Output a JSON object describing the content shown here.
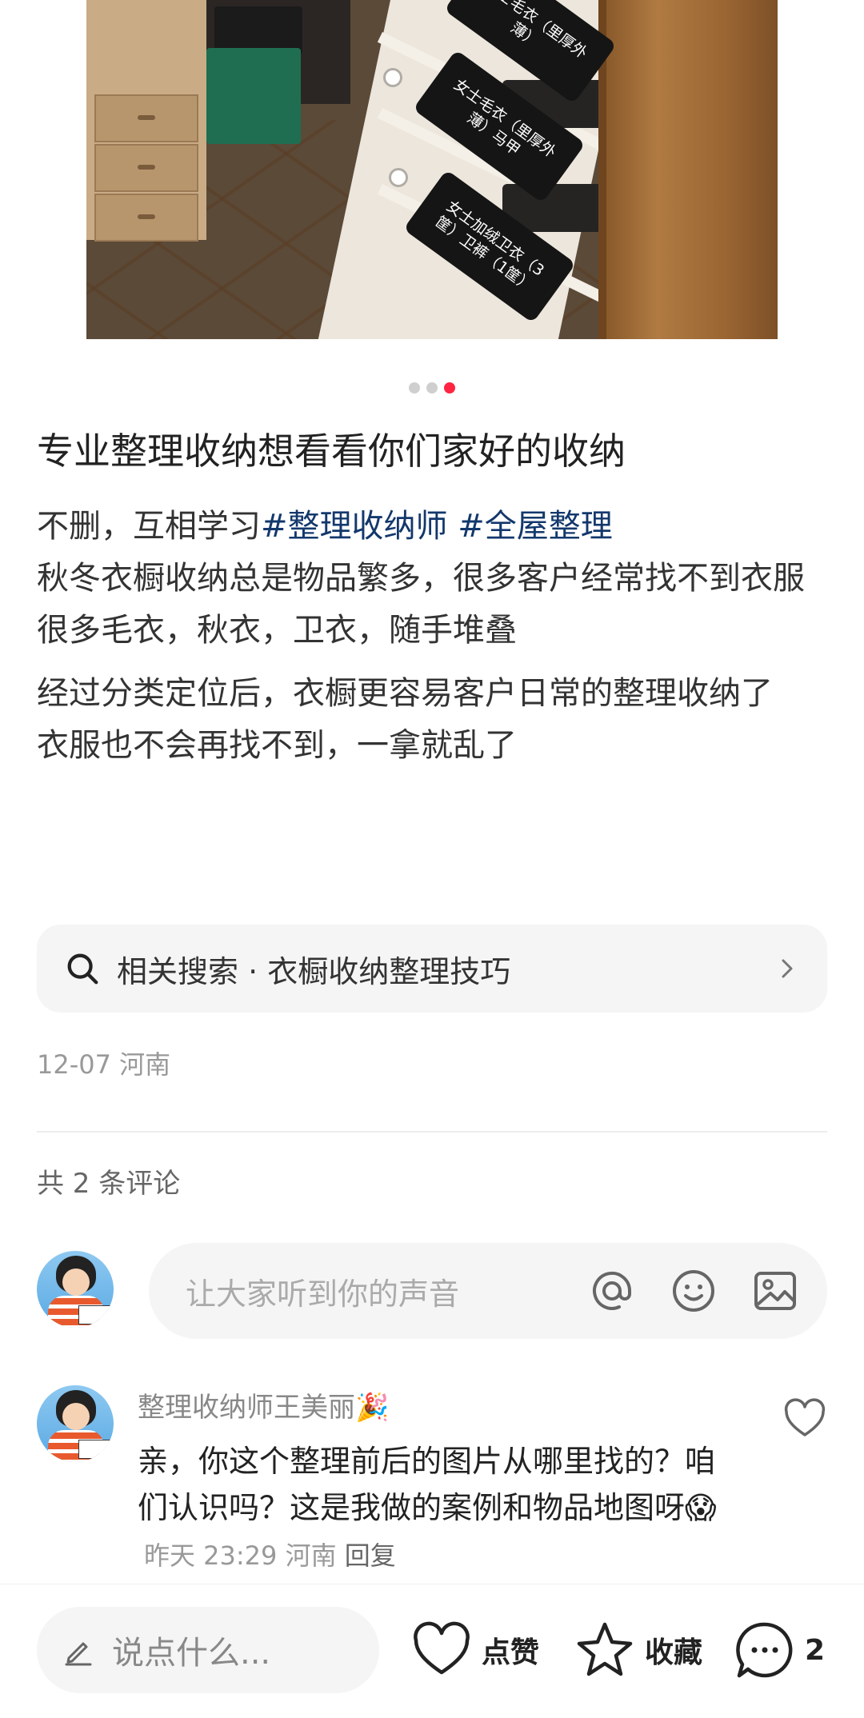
{
  "photo": {
    "tags": [
      "女士毛衣（里厚外薄）",
      "女士毛衣（里厚外薄）马甲",
      "女士加绒卫衣（3筐）卫裤（1筐）"
    ]
  },
  "carousel": {
    "total": 3,
    "active_index": 2
  },
  "post": {
    "title": "专业整理收纳想看看你们家好的收纳",
    "line1_text": "不删，互相学习",
    "hashtags": [
      "#整理收纳师",
      "#全屋整理"
    ],
    "paragraphs": [
      "秋冬衣橱收纳总是物品繁多，很多客户经常找不到衣服",
      "很多毛衣，秋衣，卫衣，随手堆叠",
      "经过分类定位后，衣橱更容易客户日常的整理收纳了",
      "衣服也不会再找不到，一拿就乱了"
    ]
  },
  "related_search": {
    "label": "相关搜索 · 衣橱收纳整理技巧"
  },
  "meta": {
    "date": "12-07",
    "location": "河南"
  },
  "comments_section": {
    "count_text": "共 2 条评论",
    "input_placeholder": "让大家听到你的声音"
  },
  "comment": {
    "author": "整理收纳师王美丽🎉",
    "text": "亲，你这个整理前后的图片从哪里找的？咱们认识吗？这是我做的案例和物品地图呀😱",
    "time": "昨天 23:29",
    "location": "河南",
    "reply_label": "回复"
  },
  "bottom_bar": {
    "say_placeholder": "说点什么...",
    "like_label": "点赞",
    "collect_label": "收藏",
    "comment_count": "2"
  },
  "colors": {
    "accent": "#ff2442",
    "hashtag": "#13386c",
    "muted": "#999999"
  }
}
